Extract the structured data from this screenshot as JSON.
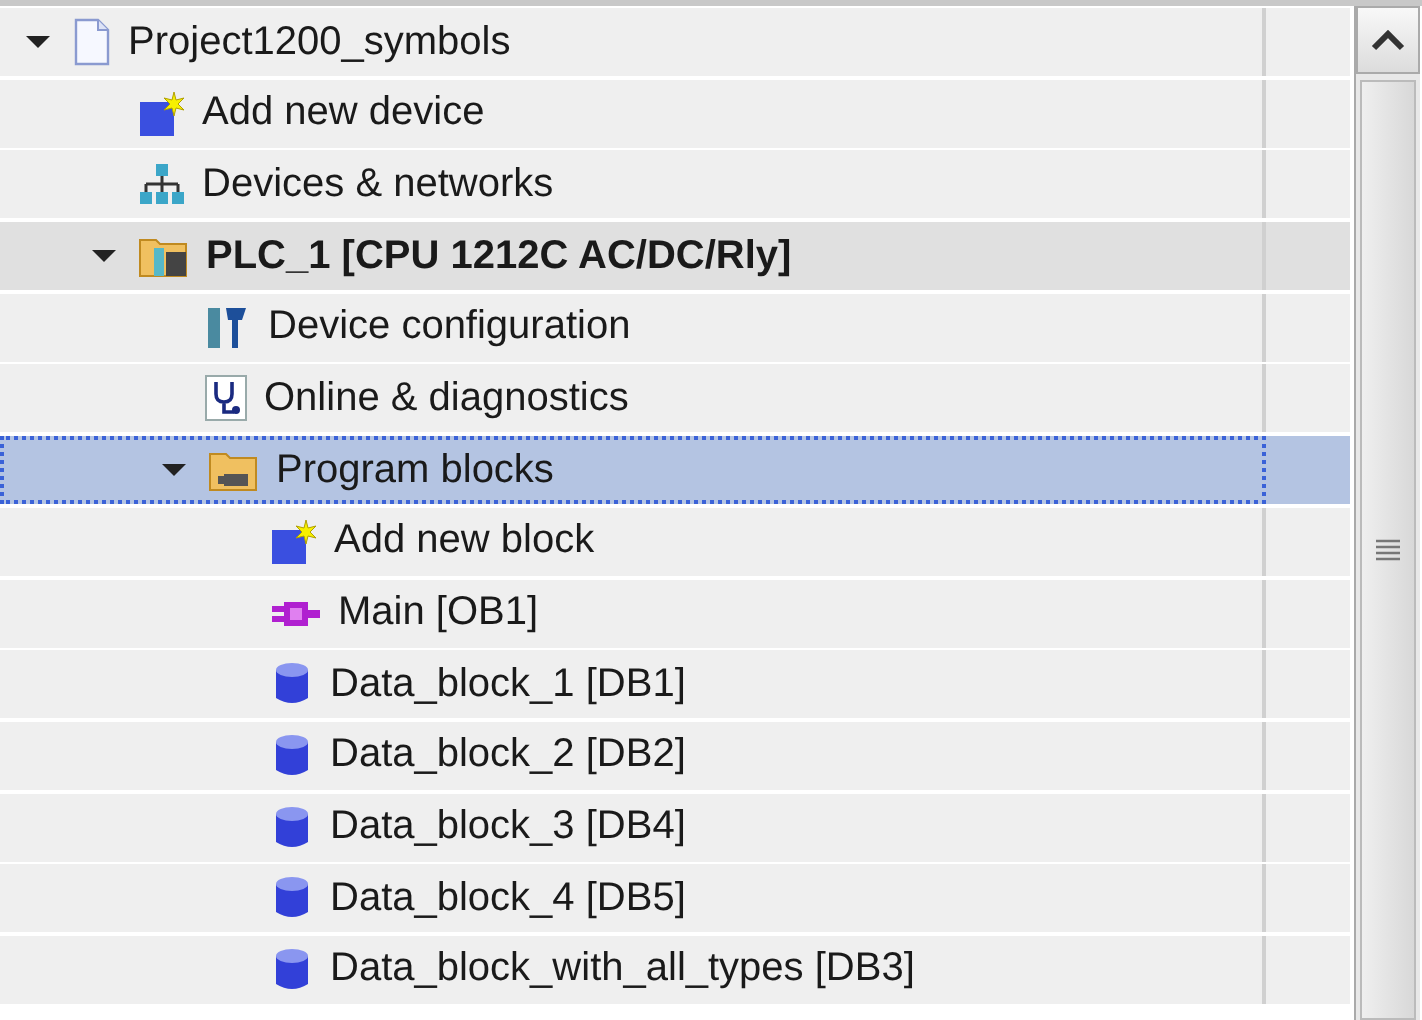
{
  "tree": [
    {
      "label": "Project1200_symbols",
      "kind": "project",
      "expanded": true,
      "selected": false,
      "children": [
        {
          "label": "Add new device",
          "kind": "add",
          "selected": false
        },
        {
          "label": "Devices & networks",
          "kind": "network",
          "selected": false
        },
        {
          "label": "PLC_1 [CPU 1212C AC/DC/Rly]",
          "kind": "plc",
          "expanded": true,
          "selected": false,
          "children": [
            {
              "label": "Device configuration",
              "kind": "config",
              "selected": false
            },
            {
              "label": "Online & diagnostics",
              "kind": "diagnostics",
              "selected": false
            },
            {
              "label": "Program blocks",
              "kind": "folder",
              "expanded": true,
              "selected": true,
              "children": [
                {
                  "label": "Add new block",
                  "kind": "add",
                  "selected": false
                },
                {
                  "label": "Main [OB1]",
                  "kind": "ob",
                  "selected": false
                },
                {
                  "label": "Data_block_1 [DB1]",
                  "kind": "db",
                  "selected": false
                },
                {
                  "label": "Data_block_2 [DB2]",
                  "kind": "db",
                  "selected": false
                },
                {
                  "label": "Data_block_3 [DB4]",
                  "kind": "db",
                  "selected": false
                },
                {
                  "label": "Data_block_4 [DB5]",
                  "kind": "db",
                  "selected": false
                },
                {
                  "label": "Data_block_with_all_types [DB3]",
                  "kind": "db",
                  "selected": false
                }
              ]
            }
          ]
        }
      ]
    }
  ]
}
